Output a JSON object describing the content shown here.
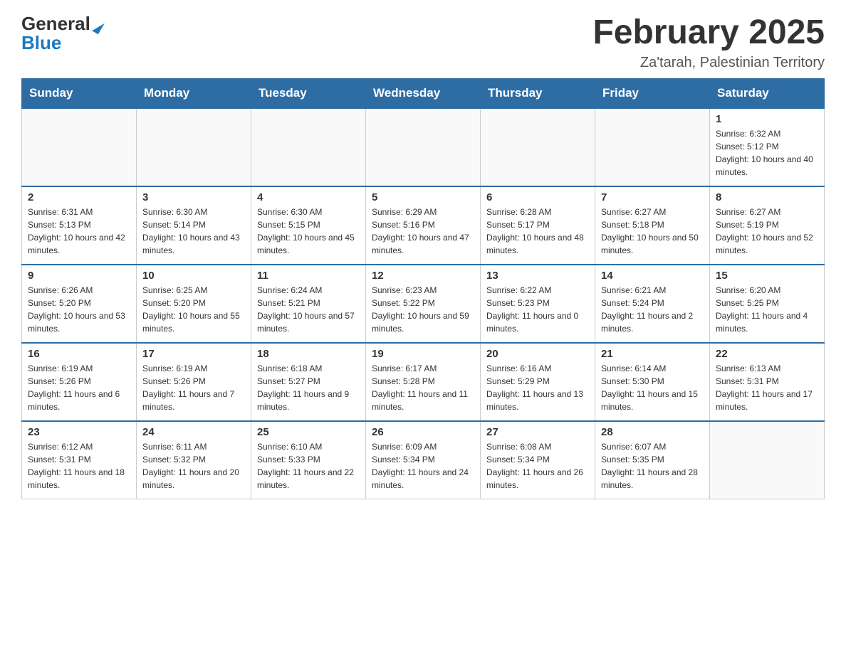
{
  "logo": {
    "general": "General",
    "blue": "Blue"
  },
  "header": {
    "month": "February 2025",
    "location": "Za'tarah, Palestinian Territory"
  },
  "days_of_week": [
    "Sunday",
    "Monday",
    "Tuesday",
    "Wednesday",
    "Thursday",
    "Friday",
    "Saturday"
  ],
  "weeks": [
    [
      {
        "day": "",
        "sunrise": "",
        "sunset": "",
        "daylight": ""
      },
      {
        "day": "",
        "sunrise": "",
        "sunset": "",
        "daylight": ""
      },
      {
        "day": "",
        "sunrise": "",
        "sunset": "",
        "daylight": ""
      },
      {
        "day": "",
        "sunrise": "",
        "sunset": "",
        "daylight": ""
      },
      {
        "day": "",
        "sunrise": "",
        "sunset": "",
        "daylight": ""
      },
      {
        "day": "",
        "sunrise": "",
        "sunset": "",
        "daylight": ""
      },
      {
        "day": "1",
        "sunrise": "Sunrise: 6:32 AM",
        "sunset": "Sunset: 5:12 PM",
        "daylight": "Daylight: 10 hours and 40 minutes."
      }
    ],
    [
      {
        "day": "2",
        "sunrise": "Sunrise: 6:31 AM",
        "sunset": "Sunset: 5:13 PM",
        "daylight": "Daylight: 10 hours and 42 minutes."
      },
      {
        "day": "3",
        "sunrise": "Sunrise: 6:30 AM",
        "sunset": "Sunset: 5:14 PM",
        "daylight": "Daylight: 10 hours and 43 minutes."
      },
      {
        "day": "4",
        "sunrise": "Sunrise: 6:30 AM",
        "sunset": "Sunset: 5:15 PM",
        "daylight": "Daylight: 10 hours and 45 minutes."
      },
      {
        "day": "5",
        "sunrise": "Sunrise: 6:29 AM",
        "sunset": "Sunset: 5:16 PM",
        "daylight": "Daylight: 10 hours and 47 minutes."
      },
      {
        "day": "6",
        "sunrise": "Sunrise: 6:28 AM",
        "sunset": "Sunset: 5:17 PM",
        "daylight": "Daylight: 10 hours and 48 minutes."
      },
      {
        "day": "7",
        "sunrise": "Sunrise: 6:27 AM",
        "sunset": "Sunset: 5:18 PM",
        "daylight": "Daylight: 10 hours and 50 minutes."
      },
      {
        "day": "8",
        "sunrise": "Sunrise: 6:27 AM",
        "sunset": "Sunset: 5:19 PM",
        "daylight": "Daylight: 10 hours and 52 minutes."
      }
    ],
    [
      {
        "day": "9",
        "sunrise": "Sunrise: 6:26 AM",
        "sunset": "Sunset: 5:20 PM",
        "daylight": "Daylight: 10 hours and 53 minutes."
      },
      {
        "day": "10",
        "sunrise": "Sunrise: 6:25 AM",
        "sunset": "Sunset: 5:20 PM",
        "daylight": "Daylight: 10 hours and 55 minutes."
      },
      {
        "day": "11",
        "sunrise": "Sunrise: 6:24 AM",
        "sunset": "Sunset: 5:21 PM",
        "daylight": "Daylight: 10 hours and 57 minutes."
      },
      {
        "day": "12",
        "sunrise": "Sunrise: 6:23 AM",
        "sunset": "Sunset: 5:22 PM",
        "daylight": "Daylight: 10 hours and 59 minutes."
      },
      {
        "day": "13",
        "sunrise": "Sunrise: 6:22 AM",
        "sunset": "Sunset: 5:23 PM",
        "daylight": "Daylight: 11 hours and 0 minutes."
      },
      {
        "day": "14",
        "sunrise": "Sunrise: 6:21 AM",
        "sunset": "Sunset: 5:24 PM",
        "daylight": "Daylight: 11 hours and 2 minutes."
      },
      {
        "day": "15",
        "sunrise": "Sunrise: 6:20 AM",
        "sunset": "Sunset: 5:25 PM",
        "daylight": "Daylight: 11 hours and 4 minutes."
      }
    ],
    [
      {
        "day": "16",
        "sunrise": "Sunrise: 6:19 AM",
        "sunset": "Sunset: 5:26 PM",
        "daylight": "Daylight: 11 hours and 6 minutes."
      },
      {
        "day": "17",
        "sunrise": "Sunrise: 6:19 AM",
        "sunset": "Sunset: 5:26 PM",
        "daylight": "Daylight: 11 hours and 7 minutes."
      },
      {
        "day": "18",
        "sunrise": "Sunrise: 6:18 AM",
        "sunset": "Sunset: 5:27 PM",
        "daylight": "Daylight: 11 hours and 9 minutes."
      },
      {
        "day": "19",
        "sunrise": "Sunrise: 6:17 AM",
        "sunset": "Sunset: 5:28 PM",
        "daylight": "Daylight: 11 hours and 11 minutes."
      },
      {
        "day": "20",
        "sunrise": "Sunrise: 6:16 AM",
        "sunset": "Sunset: 5:29 PM",
        "daylight": "Daylight: 11 hours and 13 minutes."
      },
      {
        "day": "21",
        "sunrise": "Sunrise: 6:14 AM",
        "sunset": "Sunset: 5:30 PM",
        "daylight": "Daylight: 11 hours and 15 minutes."
      },
      {
        "day": "22",
        "sunrise": "Sunrise: 6:13 AM",
        "sunset": "Sunset: 5:31 PM",
        "daylight": "Daylight: 11 hours and 17 minutes."
      }
    ],
    [
      {
        "day": "23",
        "sunrise": "Sunrise: 6:12 AM",
        "sunset": "Sunset: 5:31 PM",
        "daylight": "Daylight: 11 hours and 18 minutes."
      },
      {
        "day": "24",
        "sunrise": "Sunrise: 6:11 AM",
        "sunset": "Sunset: 5:32 PM",
        "daylight": "Daylight: 11 hours and 20 minutes."
      },
      {
        "day": "25",
        "sunrise": "Sunrise: 6:10 AM",
        "sunset": "Sunset: 5:33 PM",
        "daylight": "Daylight: 11 hours and 22 minutes."
      },
      {
        "day": "26",
        "sunrise": "Sunrise: 6:09 AM",
        "sunset": "Sunset: 5:34 PM",
        "daylight": "Daylight: 11 hours and 24 minutes."
      },
      {
        "day": "27",
        "sunrise": "Sunrise: 6:08 AM",
        "sunset": "Sunset: 5:34 PM",
        "daylight": "Daylight: 11 hours and 26 minutes."
      },
      {
        "day": "28",
        "sunrise": "Sunrise: 6:07 AM",
        "sunset": "Sunset: 5:35 PM",
        "daylight": "Daylight: 11 hours and 28 minutes."
      },
      {
        "day": "",
        "sunrise": "",
        "sunset": "",
        "daylight": ""
      }
    ]
  ]
}
